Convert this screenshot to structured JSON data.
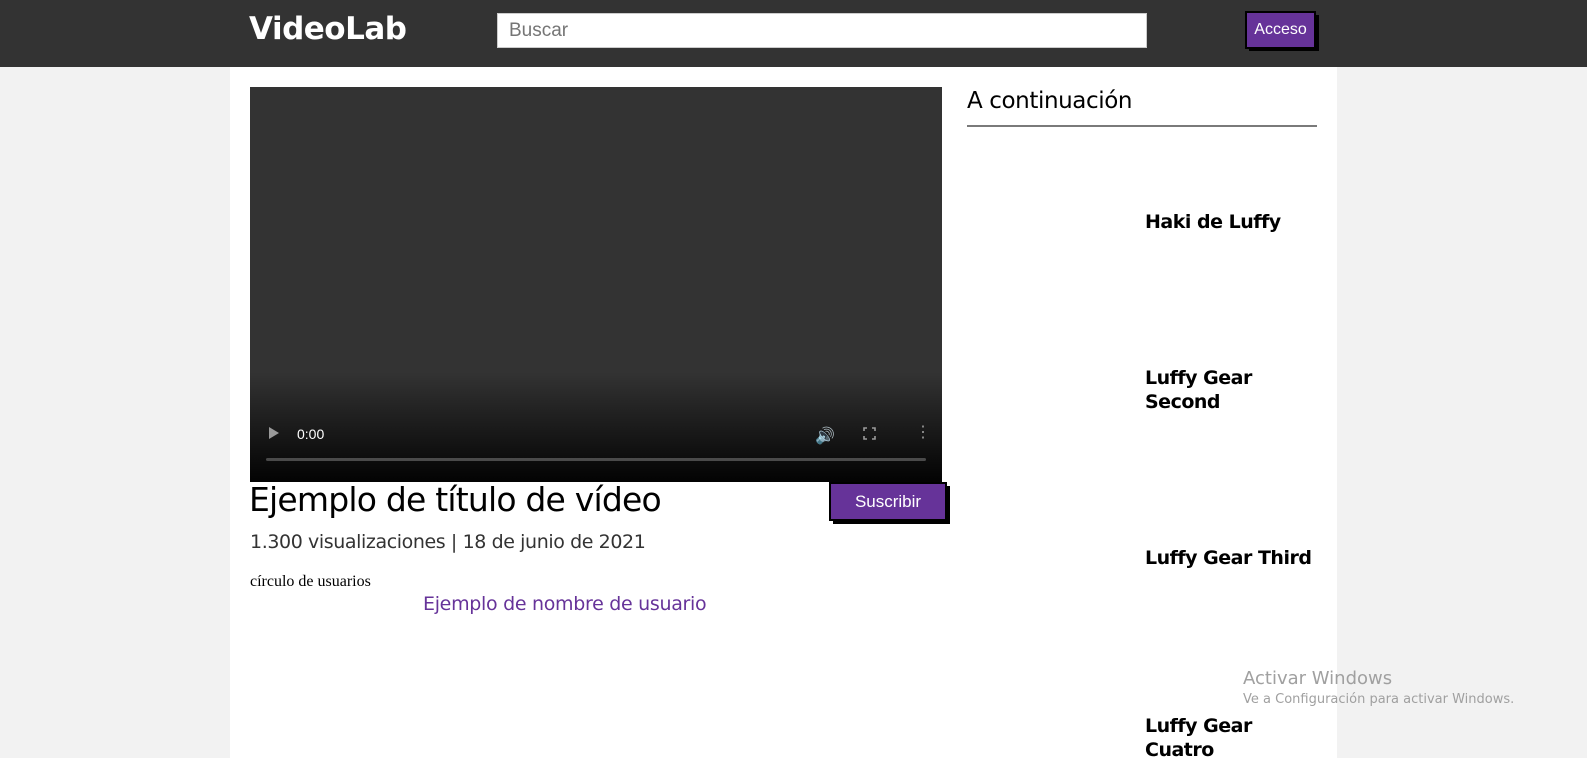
{
  "header": {
    "logo": "VideoLab",
    "search_placeholder": "Buscar",
    "login_label": "Acceso"
  },
  "video": {
    "current_time": "0:00",
    "title": "Ejemplo de título de vídeo",
    "meta": "1.300 visualizaciones | 18 de junio de 2021",
    "subscribe_label": "Suscribir",
    "avatar_alt": "círculo de usuarios",
    "username": "Ejemplo de nombre de usuario"
  },
  "sidebar": {
    "heading": "A continuación",
    "items": [
      {
        "label": "Haki de Luffy"
      },
      {
        "label": "Luffy Gear Second"
      },
      {
        "label": "Luffy Gear Third"
      },
      {
        "label": "Luffy Gear Cuatro"
      }
    ]
  },
  "watermark": {
    "title": "Activar Windows",
    "subtitle": "Ve a Configuración para activar Windows."
  },
  "colors": {
    "topbar": "#333333",
    "accent": "#663399",
    "page_bg": "#f2f2f2"
  }
}
